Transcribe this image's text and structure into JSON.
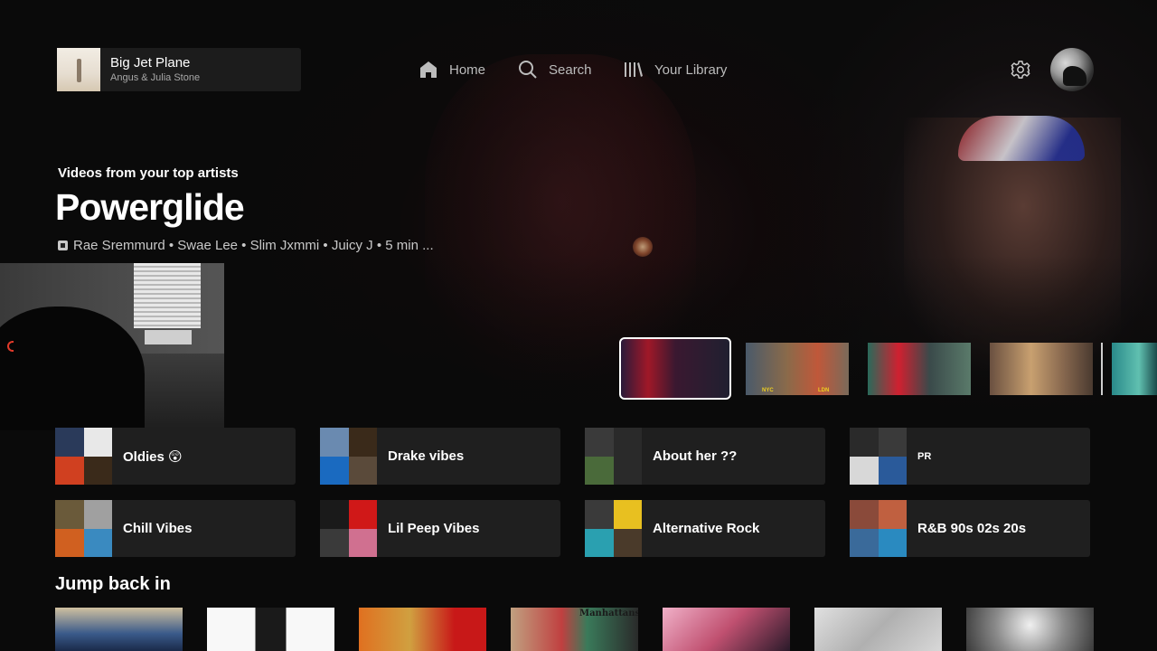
{
  "now_playing": {
    "title": "Big Jet Plane",
    "artist": "Angus & Julia Stone"
  },
  "nav": {
    "home": "Home",
    "search": "Search",
    "library": "Your Library"
  },
  "hero": {
    "eyebrow": "Videos from your top artists",
    "title": "Powerglide",
    "meta": "Rae Sremmurd • Swae Lee • Slim Jxmmi • Juicy J • 5 min ..."
  },
  "carousel": {
    "thumb2_labels": [
      "NYC",
      "LDN"
    ]
  },
  "playlists": [
    {
      "label": "Oldies 😲",
      "art": [
        "#2a3a5a",
        "#e8e8e8",
        "#d04020",
        "#3a2a1a"
      ]
    },
    {
      "label": "Drake vibes",
      "art": [
        "#6a8ab0",
        "#3a2a1a",
        "#1a6ac0",
        "#5a4a3a"
      ]
    },
    {
      "label": "About her ??",
      "art": [
        "#3a3a3a",
        "#2a2a2a",
        "#4a6a3a",
        "#2a2a2a"
      ]
    },
    {
      "label": "PR",
      "art": [
        "#2a2a2a",
        "#3a3a3a",
        "#d8d8d8",
        "#2a5a9a"
      ]
    },
    {
      "label": "Chill Vibes",
      "art": [
        "#6a5a3a",
        "#a0a0a0",
        "#d06020",
        "#3a8ac0"
      ]
    },
    {
      "label": "Lil Peep Vibes",
      "art": [
        "#1a1a1a",
        "#d01818",
        "#3a3a3a",
        "#d07090"
      ]
    },
    {
      "label": "Alternative Rock",
      "art": [
        "#3a3a3a",
        "#e8c020",
        "#2aa0b0",
        "#4a3a2a"
      ]
    },
    {
      "label": "R&B 90s 02s 20s",
      "art": [
        "#8a4a3a",
        "#c06040",
        "#3a6a9a",
        "#2a8ac0"
      ]
    }
  ],
  "jump_back_in": {
    "title": "Jump back in",
    "items": [
      {
        "name": "jump-item-1",
        "art": "linear-gradient(180deg, #d0c0a0 0%, #3a5a8a 60%, #1a2a4a 100%)"
      },
      {
        "name": "jump-item-2",
        "art": "linear-gradient(90deg, #f8f8f8 0%, #f8f8f8 38%, #1a1a1a 38%, #1a1a1a 62%, #f8f8f8 62%, #f8f8f8 100%)"
      },
      {
        "name": "jump-item-3",
        "art": "linear-gradient(90deg, #e07020 0%, #d0a040 40%, #c81818 75%, #c81818 100%)"
      },
      {
        "name": "jump-item-4",
        "art": "linear-gradient(90deg, #c0a080 0%, #c04040 40%, #3a7a5a 60%, #2a2a2a 100%)",
        "text": "Manhattans"
      },
      {
        "name": "jump-item-5",
        "art": "linear-gradient(135deg, #f0b0c8 0%, #c05070 50%, #2a1a2a 100%)"
      },
      {
        "name": "jump-item-6",
        "art": "linear-gradient(135deg, #e0e0e0 0%, #b0b0b0 50%, #d8d8d8 100%)"
      },
      {
        "name": "jump-item-7",
        "art": "radial-gradient(circle at 50% 40%, #f0f0f0 0%, #8a8a8a 50%, #3a3a3a 100%)"
      }
    ]
  }
}
